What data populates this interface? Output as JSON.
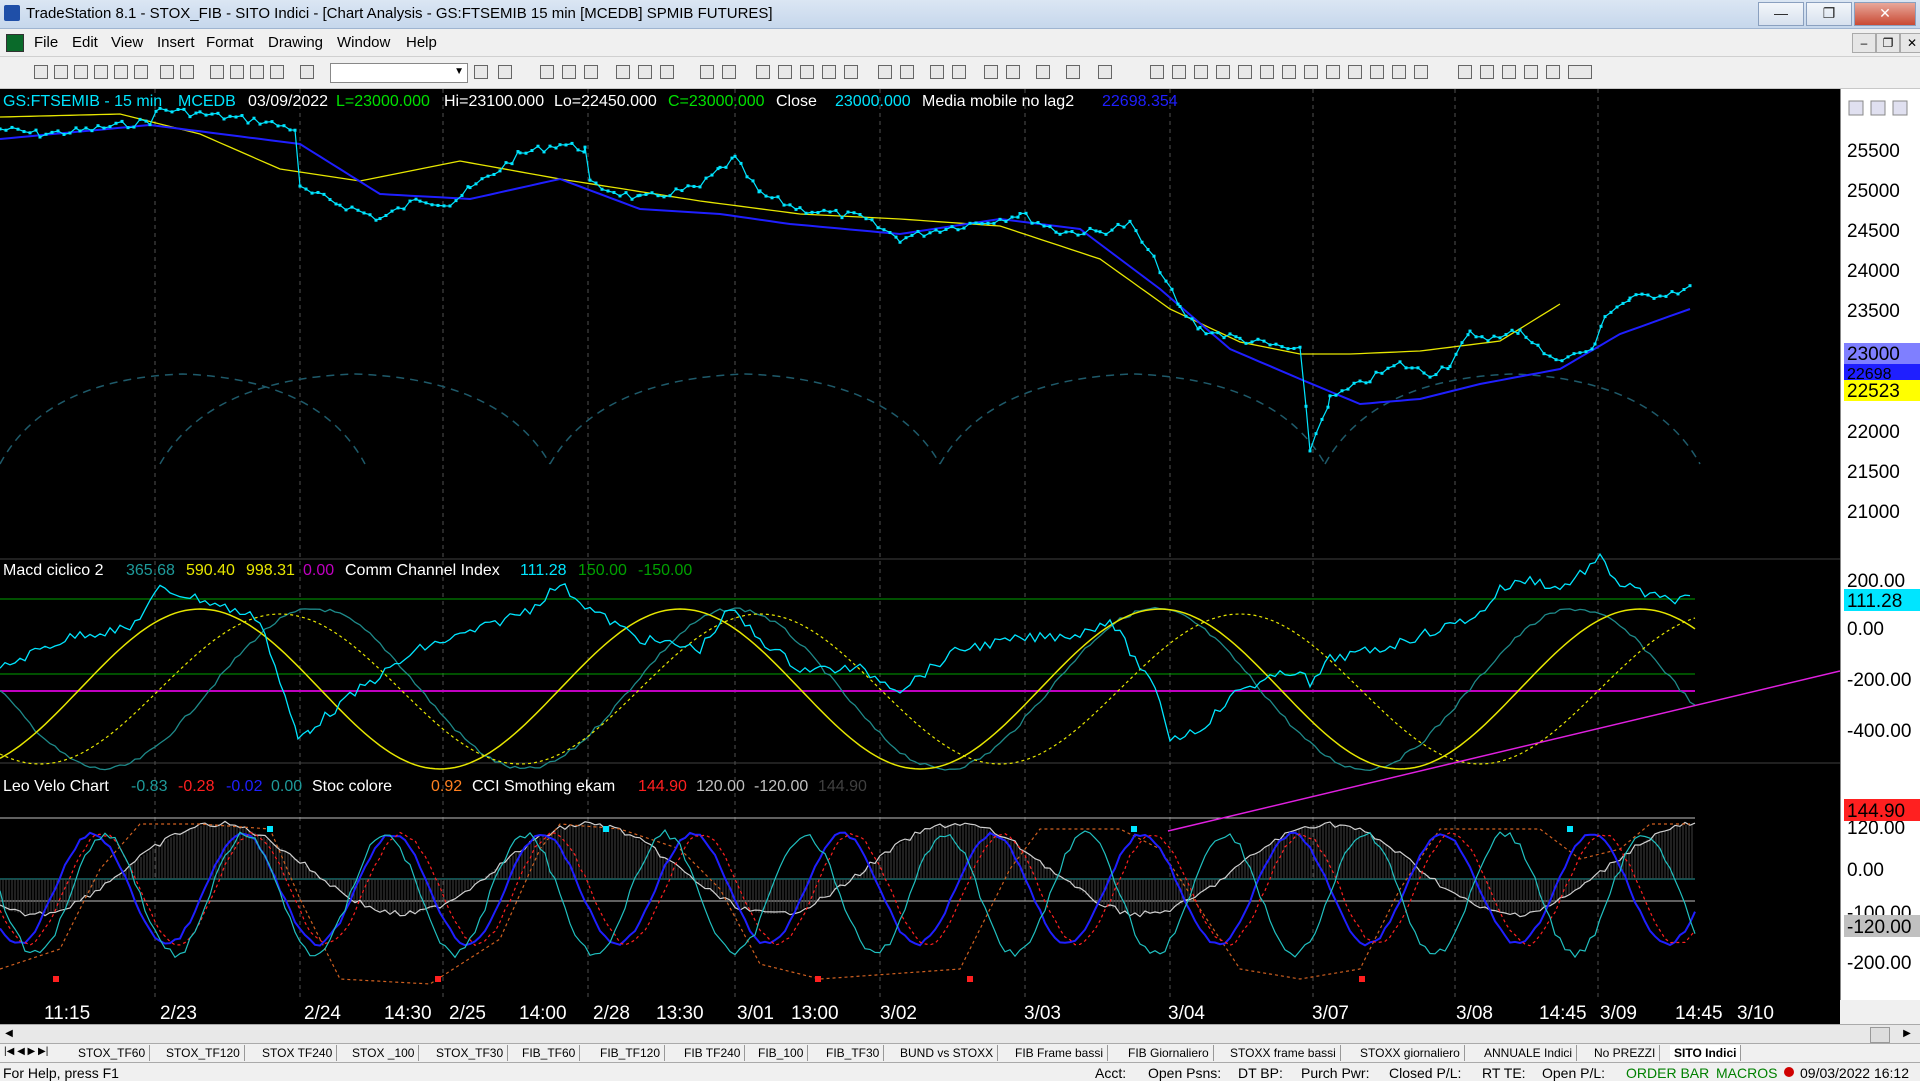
{
  "window": {
    "title": "TradeStation 8.1 - STOX_FIB - SITO Indici - [Chart Analysis - GS:FTSEMIB  15 min  [MCEDB] SPMIB FUTURES]",
    "min": "—",
    "max": "❐",
    "close": "✕"
  },
  "menu": [
    "File",
    "Edit",
    "View",
    "Insert",
    "Format",
    "Drawing",
    "Window",
    "Help"
  ],
  "mdi": {
    "min": "–",
    "restore": "❐",
    "close": "✕"
  },
  "colors": {
    "price": "#00e5ff",
    "ma_blue": "#1f1fff",
    "ma_yellow": "#e6e600",
    "bg": "#000000",
    "grid": "#808080"
  },
  "panel1": {
    "symbol": "GS:FTSEMIB - 15 min",
    "datasrc": "MCEDB",
    "date": "03/09/2022",
    "last": "L=23000.000",
    "hi": "Hi=23100.000",
    "lo": "Lo=22450.000",
    "close_eq": "C=23000.000",
    "close_label": "Close",
    "close_val": "23000.000",
    "ma_label": "Media mobile no lag2",
    "ma_val": "22698.354",
    "axis": [
      "25500",
      "25000",
      "24500",
      "24000",
      "23500",
      "23000",
      "22000",
      "21500",
      "21000"
    ],
    "tag_price": "23000",
    "tag_ma_blue": "22698",
    "tag_ma_yellow": "22523"
  },
  "panel2": {
    "name": "Macd ciclico 2",
    "v1": "365.68",
    "v2": "590.40",
    "v3": "998.31",
    "v4": "0.00",
    "cci_name": "Comm Channel Index",
    "cci_v": "111.28",
    "lvl_hi": "150.00",
    "lvl_lo": "-150.00",
    "axis": [
      "200.00",
      "0.00",
      "-200.00",
      "-400.00"
    ],
    "tag": "111.28"
  },
  "panel3": {
    "name": "Leo Velo Chart",
    "v1": "-0.83",
    "v2": "-0.28",
    "v3": "-0.02",
    "v4": "0.00",
    "stoc_name": "Stoc colore",
    "stoc_v": "0.92",
    "cci_name": "CCI Smothing ekam",
    "cci_v": "144.90",
    "lvl_hi": "120.00",
    "lvl_lo": "-120.00",
    "cci_v2": "144.90",
    "axis": [
      "120.00",
      "0.00",
      "-100.00",
      "-200.00"
    ],
    "tag_top": "144.90",
    "tag_bottom": "-120.00"
  },
  "xaxis": [
    "11:15",
    "2/23",
    "2/24",
    "14:30",
    "2/25",
    "14:00",
    "2/28",
    "13:30",
    "3/01",
    "13:00",
    "3/02",
    "3/03",
    "3/04",
    "3/07",
    "3/08",
    "14:45",
    "3/09",
    "14:45",
    "3/10"
  ],
  "tabs": [
    "STOX_TF60",
    "STOX_TF120",
    "STOX TF240",
    "STOX _100",
    "STOX_TF30",
    "FIB_TF60",
    "FIB_TF120",
    "FIB TF240",
    "FIB_100",
    "FIB_TF30",
    "BUND vs STOXX",
    "FIB Frame bassi",
    "FIB Giornaliero",
    "STOXX frame bassi",
    "STOXX giornaliero",
    "ANNUALE Indici",
    "No PREZZI",
    "SITO Indici"
  ],
  "status": {
    "help": "For Help, press F1",
    "acct": "Acct:",
    "open_psns": "Open Psns:",
    "dt_bp": "DT BP:",
    "purch_pwr": "Purch Pwr:",
    "closed_pl": "Closed P/L:",
    "rt_te": "RT TE:",
    "open_pl": "Open P/L:",
    "order_bar": "ORDER BAR",
    "macros": "MACROS",
    "datetime": "09/03/2022 16:12"
  }
}
